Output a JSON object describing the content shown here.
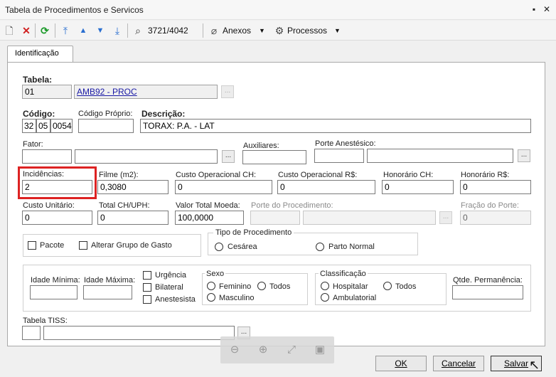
{
  "window": {
    "title": "Tabela de Procedimentos e Servicos"
  },
  "toolbar": {
    "record_counter": "3721/4042",
    "attachments_label": "Anexos",
    "processes_label": "Processos"
  },
  "tabs": [
    {
      "label": "Identificação"
    }
  ],
  "form": {
    "tabela": {
      "label": "Tabela:",
      "code": "01",
      "name": "AMB92 - PROC"
    },
    "codigo": {
      "label": "Código:",
      "parts": [
        "32",
        "05",
        "0054"
      ]
    },
    "codigo_proprio": {
      "label": "Código Próprio:",
      "value": ""
    },
    "descricao": {
      "label": "Descrição:",
      "value": "TORAX: P.A. - LAT"
    },
    "fator": {
      "label": "Fator:",
      "code": "",
      "name": ""
    },
    "auxiliares": {
      "label": "Auxiliares:",
      "value": ""
    },
    "porte_anestesico": {
      "label": "Porte Anestésico:",
      "code": "",
      "name": ""
    },
    "incidencias": {
      "label": "Incidências:",
      "value": "2"
    },
    "filme": {
      "label": "Filme (m2):",
      "value": "0,3080"
    },
    "custo_operacional_ch": {
      "label": "Custo Operacional CH:",
      "value": "0"
    },
    "custo_operacional_rs": {
      "label": "Custo Operacional R$:",
      "value": "0"
    },
    "honorario_ch": {
      "label": "Honorário CH:",
      "value": "0"
    },
    "honorario_rs": {
      "label": "Honorário R$:",
      "value": "0"
    },
    "custo_unitario": {
      "label": "Custo Unitário:",
      "value": "0"
    },
    "total_ch_uph": {
      "label": "Total CH/UPH:",
      "value": "0"
    },
    "valor_total_moeda": {
      "label": "Valor Total Moeda:",
      "value": "100,0000"
    },
    "porte_procedimento": {
      "label": "Porte do Procedimento:",
      "code": "",
      "name": ""
    },
    "fracao_porte": {
      "label": "Fração do Porte:",
      "value": "0"
    },
    "pacote": {
      "label": "Pacote",
      "checked": false
    },
    "alterar_grupo": {
      "label": "Alterar Grupo de Gasto",
      "checked": false
    },
    "tipo_procedimento": {
      "label": "Tipo de Procedimento",
      "options": [
        "Cesárea",
        "Parto Normal"
      ]
    },
    "idade_minima": {
      "label": "Idade Mínima:",
      "value": ""
    },
    "idade_maxima": {
      "label": "Idade Máxima:",
      "value": ""
    },
    "flags": {
      "urgencia": "Urgência",
      "bilateral": "Bilateral",
      "anestesista": "Anestesista"
    },
    "sexo": {
      "label": "Sexo",
      "options": [
        "Feminino",
        "Todos",
        "Masculino"
      ]
    },
    "classificacao": {
      "label": "Classificação",
      "options": [
        "Hospitalar",
        "Todos",
        "Ambulatorial"
      ]
    },
    "qtde_permanencia": {
      "label": "Qtde. Permanência:",
      "value": ""
    },
    "tabela_tiss": {
      "label": "Tabela TISS:",
      "code": "",
      "name": ""
    }
  },
  "buttons": {
    "ok": "OK",
    "cancel": "Cancelar",
    "save": "Salvar"
  },
  "colors": {
    "highlight": "#d22222",
    "link": "#1a1aa6",
    "refresh": "#1c9a2a",
    "delete": "#d02020"
  }
}
